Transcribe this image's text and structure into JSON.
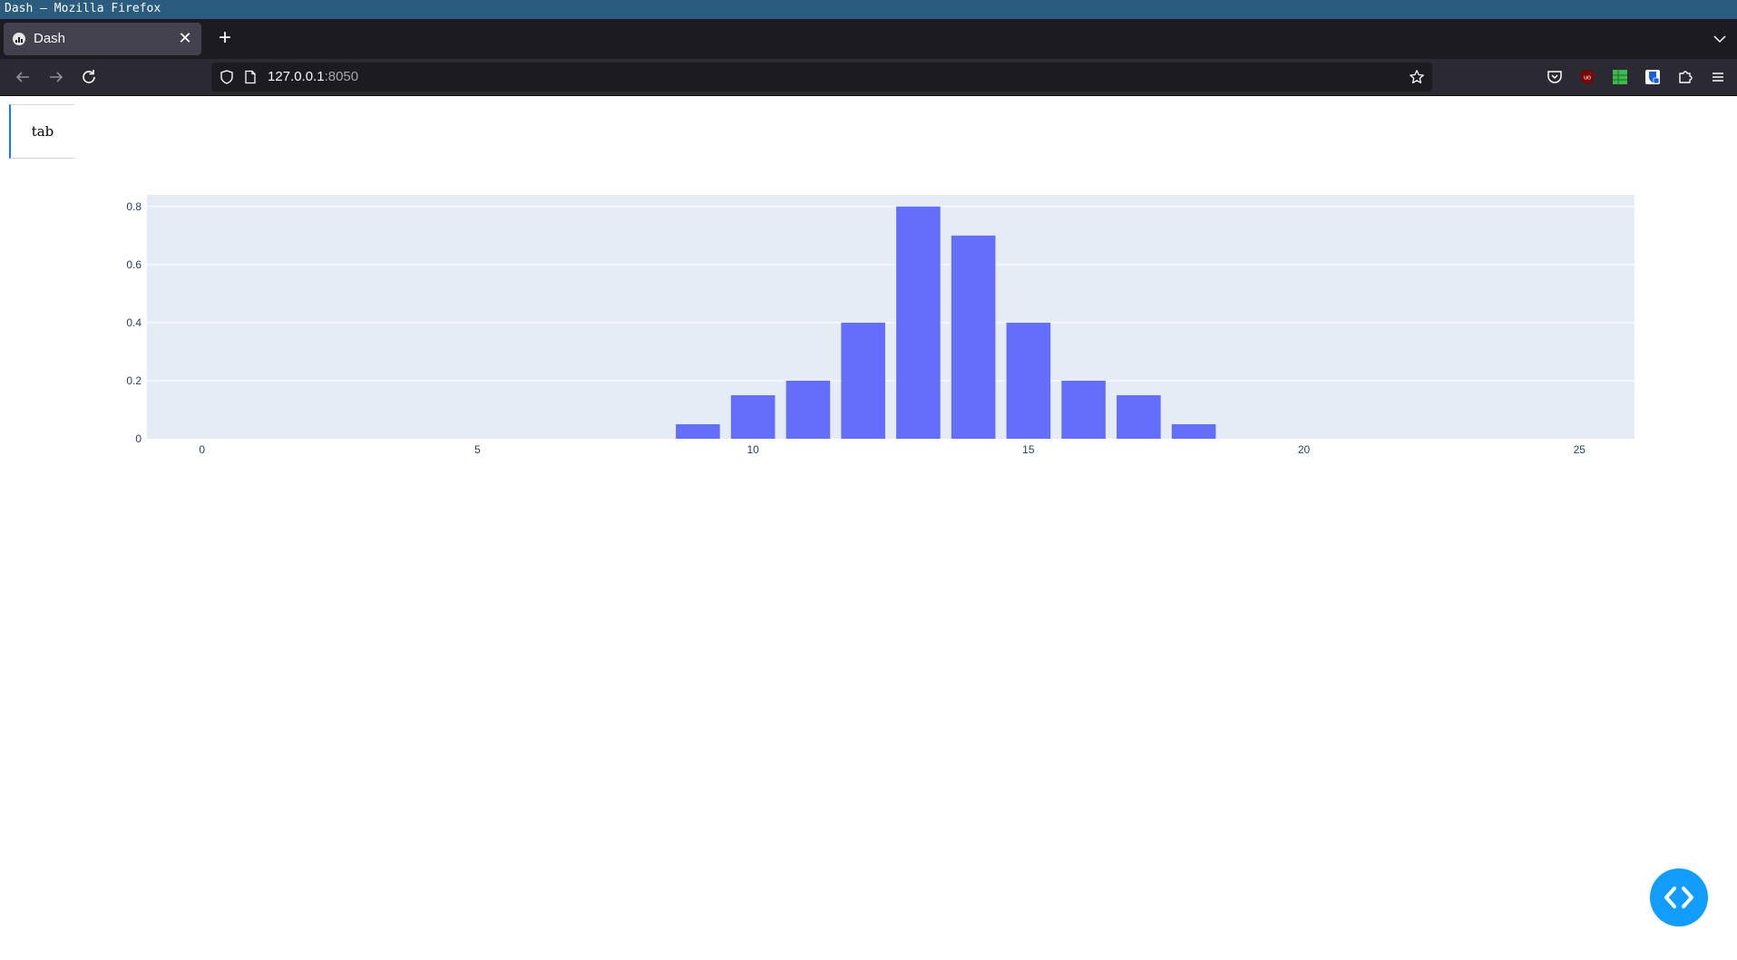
{
  "window": {
    "title": "Dash — Mozilla Firefox"
  },
  "browser": {
    "tab": {
      "title": "Dash",
      "close_glyph": "✕"
    },
    "new_tab_glyph": "+",
    "url": {
      "host": "127.0.0.1",
      "port": ":8050"
    }
  },
  "page": {
    "tabs": [
      {
        "label": "tab"
      }
    ]
  },
  "colors": {
    "bar": "#636efa",
    "plot_bg": "#e5ecf6",
    "accent": "#1975fa",
    "dev_button": "#119dff"
  },
  "chart_data": {
    "type": "bar",
    "x": [
      9,
      10,
      11,
      12,
      13,
      14,
      15,
      16,
      17,
      18
    ],
    "values": [
      0.05,
      0.15,
      0.2,
      0.4,
      0.8,
      0.7,
      0.4,
      0.2,
      0.15,
      0.05
    ],
    "xlim": [
      -1,
      26
    ],
    "ylim": [
      0,
      0.84
    ],
    "x_ticks": [
      0,
      5,
      10,
      15,
      20,
      25
    ],
    "y_ticks": [
      0,
      0.2,
      0.4,
      0.6,
      0.8
    ],
    "x_tick_labels": [
      "0",
      "5",
      "10",
      "15",
      "20",
      "25"
    ],
    "y_tick_labels": [
      "0",
      "0.2",
      "0.4",
      "0.6",
      "0.8"
    ],
    "grid": true,
    "title": "",
    "xlabel": "",
    "ylabel": ""
  }
}
